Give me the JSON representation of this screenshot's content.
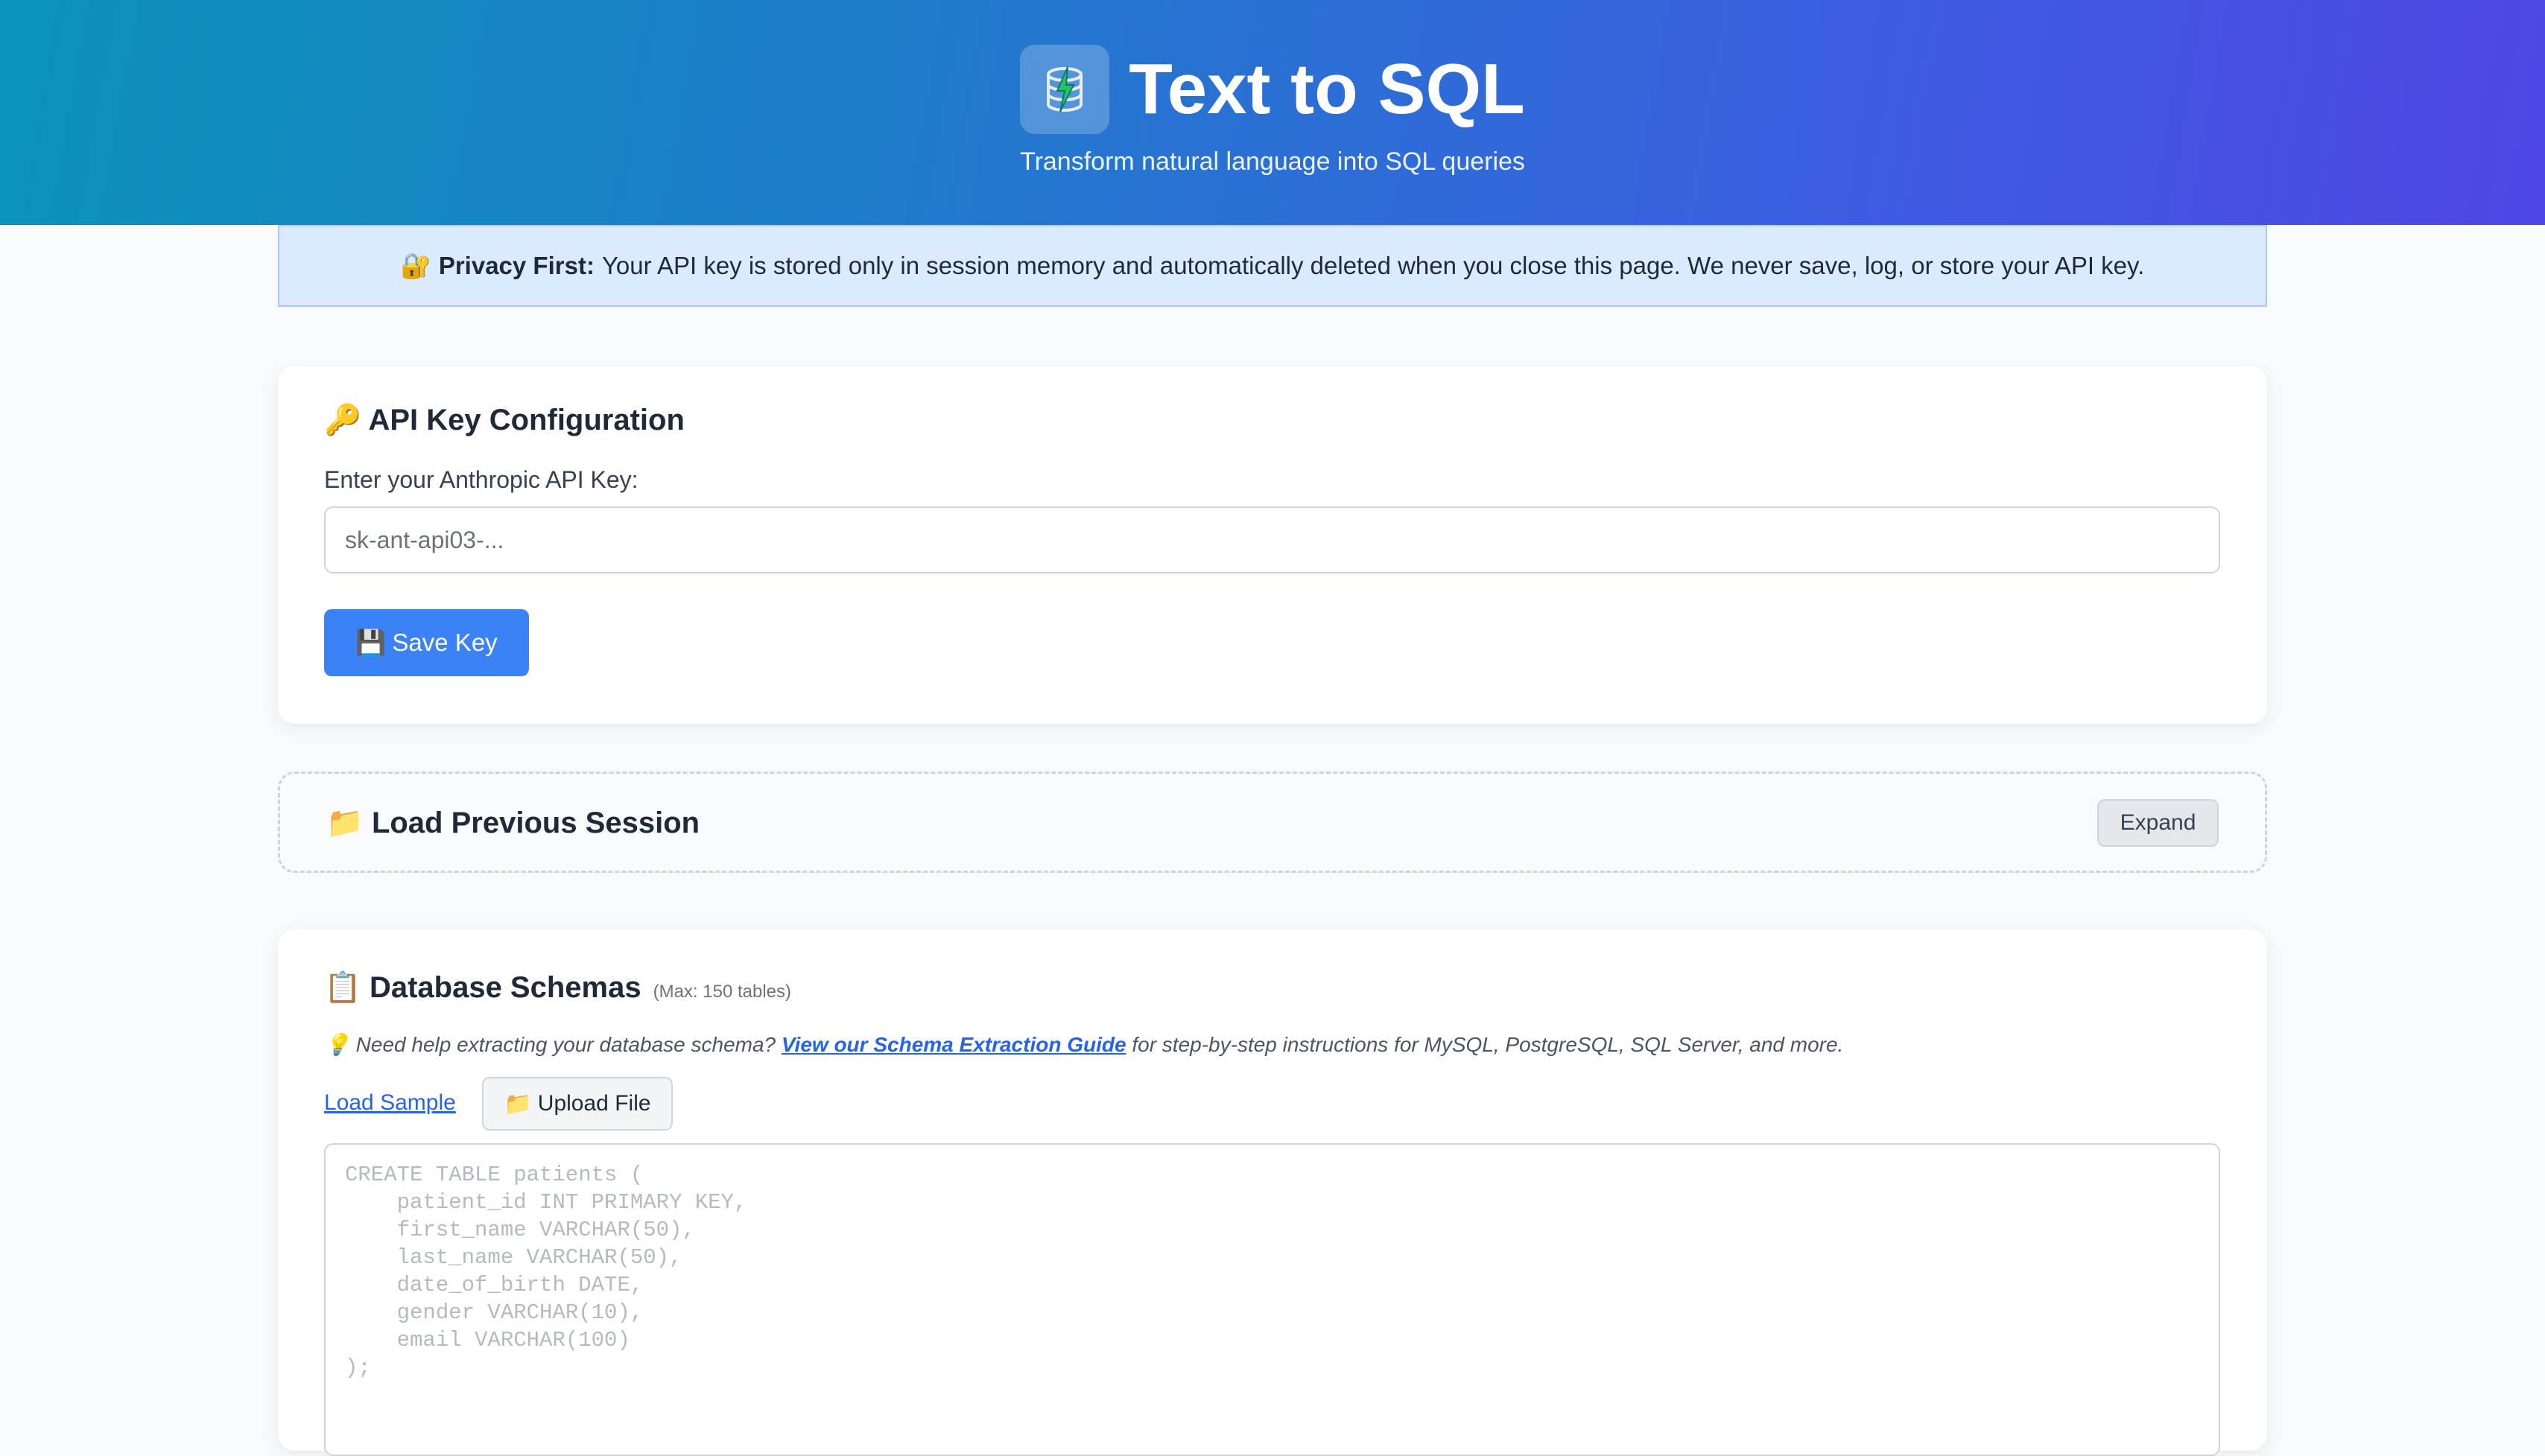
{
  "header": {
    "title": "Text to SQL",
    "subtitle": "Transform natural language into SQL queries",
    "icon": "database-bolt-icon",
    "gradient_start": "#0a93b8",
    "gradient_end": "#4f46e5"
  },
  "privacy": {
    "emoji": "🔐",
    "label": "Privacy First:",
    "text": "Your API key is stored only in session memory and automatically deleted when you close this page. We never save, log, or store your API key."
  },
  "api_key": {
    "emoji": "🔑",
    "title": "API Key Configuration",
    "field_label": "Enter your Anthropic API Key:",
    "placeholder": "sk-ant-api03-...",
    "value": "",
    "save_emoji": "💾",
    "save_label": "Save Key",
    "accent": "#3b82f6"
  },
  "session": {
    "emoji": "📁",
    "title": "Load Previous Session",
    "expand_label": "Expand"
  },
  "schemas": {
    "emoji": "📋",
    "title": "Database Schemas",
    "max_note": "(Max: 150 tables)",
    "help_emoji": "💡",
    "help_prefix": "Need help extracting your database schema?",
    "help_link": "View our Schema Extraction Guide",
    "help_suffix": "for step-by-step instructions for MySQL, PostgreSQL, SQL Server, and more.",
    "load_sample_label": "Load Sample",
    "upload_emoji": "📁",
    "upload_label": "Upload File",
    "placeholder": "CREATE TABLE patients (\n    patient_id INT PRIMARY KEY,\n    first_name VARCHAR(50),\n    last_name VARCHAR(50),\n    date_of_birth DATE,\n    gender VARCHAR(10),\n    email VARCHAR(100)\n);"
  }
}
